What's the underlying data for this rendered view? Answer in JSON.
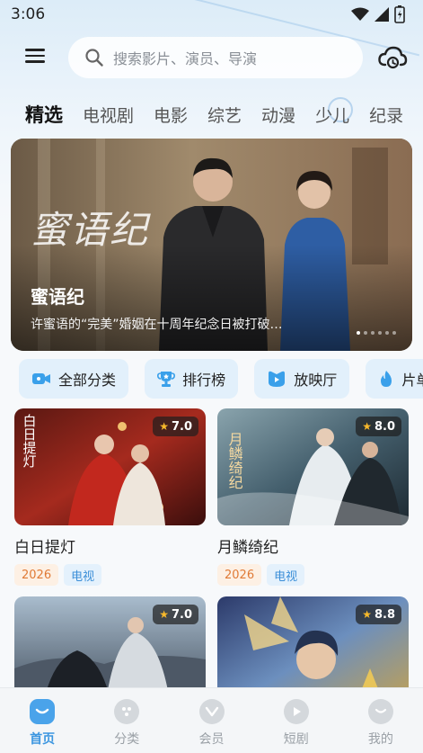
{
  "status_bar": {
    "time": "3:06"
  },
  "search": {
    "placeholder": "搜索影片、演员、导演"
  },
  "tabs": [
    "精选",
    "电视剧",
    "电影",
    "综艺",
    "动漫",
    "少儿",
    "纪录"
  ],
  "banner": {
    "title": "蜜语纪",
    "calligraphy": "蜜语纪",
    "description": "许蜜语的“完美”婚姻在十周年纪念日被打破…",
    "dots_total": 6,
    "dots_active": 1
  },
  "quick_nav": [
    "全部分类",
    "排行榜",
    "放映厅",
    "片单"
  ],
  "cards": [
    {
      "title": "白日提灯",
      "rating": "7.0",
      "year": "2026",
      "type": "电视",
      "poster_text": "白日提灯"
    },
    {
      "title": "月鳞绮纪",
      "rating": "8.0",
      "year": "2026",
      "type": "电视",
      "poster_text": "月鳞绮纪"
    },
    {
      "title": "",
      "rating": "7.0",
      "year": "",
      "type": "",
      "poster_text": ""
    },
    {
      "title": "",
      "rating": "8.8",
      "year": "",
      "type": "",
      "poster_text": ""
    }
  ],
  "bottom_nav": [
    "首页",
    "分类",
    "会员",
    "短剧",
    "我的"
  ],
  "colors": {
    "accent": "#3c96e0",
    "year_tag": "#e07a36",
    "type_tag": "#3c8fd8",
    "star": "#f8b92b"
  }
}
